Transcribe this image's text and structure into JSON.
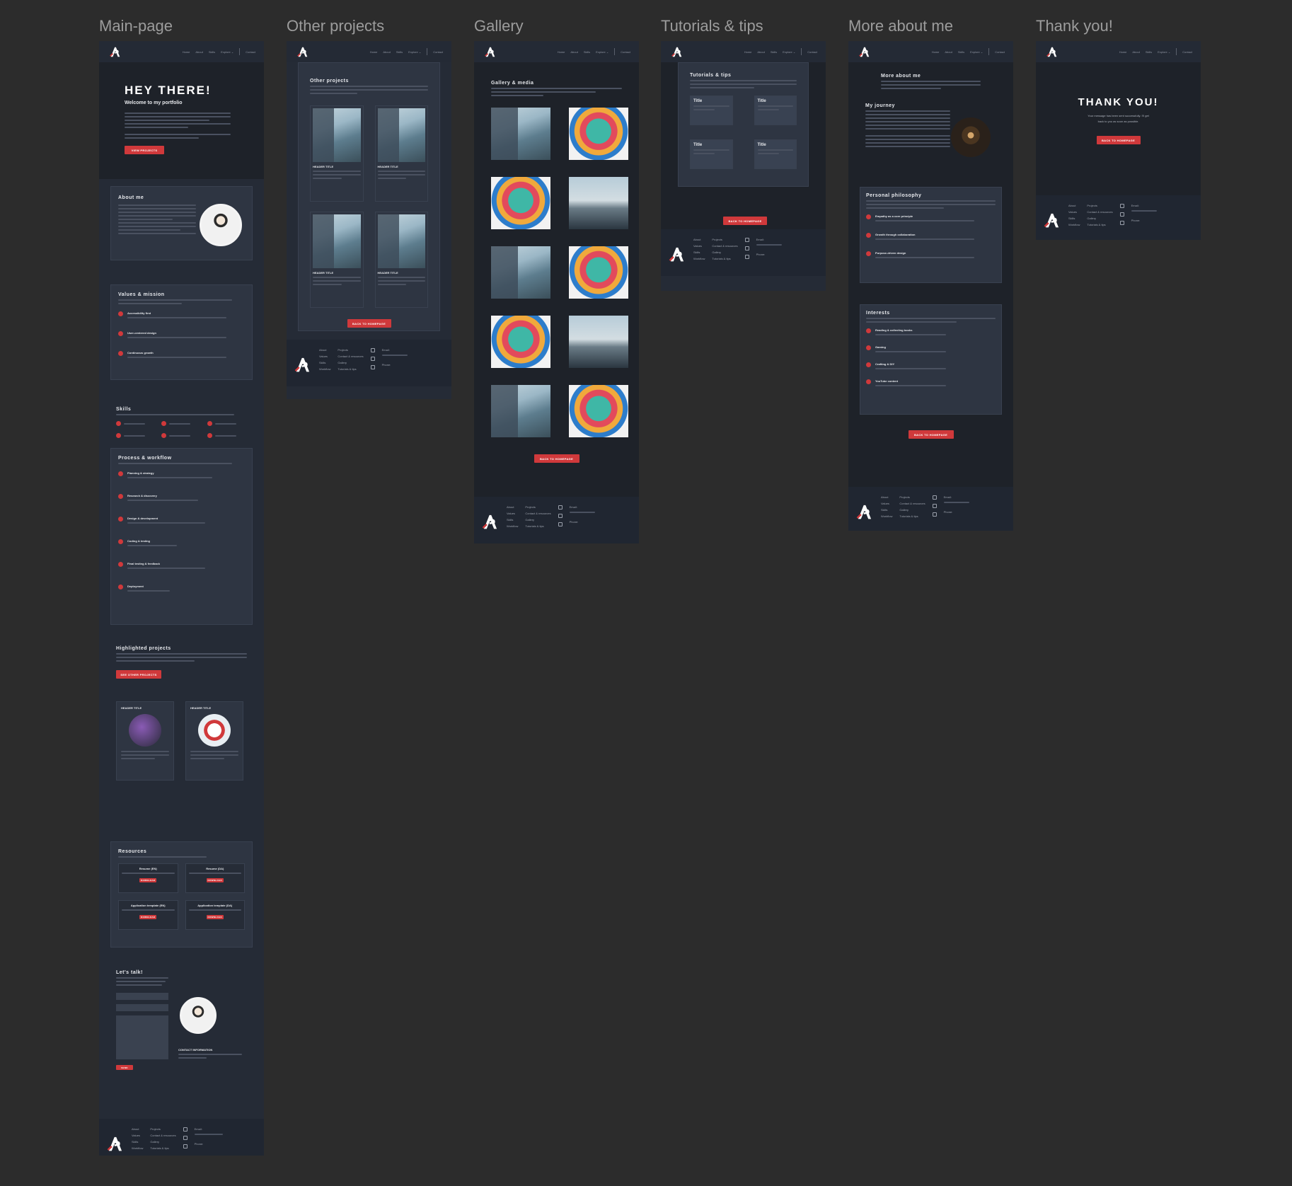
{
  "frames": {
    "main": "Main-page",
    "other": "Other projects",
    "gallery": "Gallery",
    "tutorials": "Tutorials & tips",
    "more": "More about me",
    "thanks": "Thank you!"
  },
  "nav": {
    "home": "Home",
    "about": "About",
    "skills": "Skills",
    "explore": "Explore ⌄",
    "contact": "Contact"
  },
  "main": {
    "hero_title": "HEY THERE!",
    "hero_sub": "Welcome to my portfolio",
    "view_projects": "VIEW PROJECTS",
    "about_title": "About me",
    "values_title": "Values & mission",
    "values": [
      {
        "title": "Accessibility first"
      },
      {
        "title": "User-centered design"
      },
      {
        "title": "Continuous growth"
      }
    ],
    "skills_title": "Skills",
    "process_title": "Process & workflow",
    "process": [
      {
        "title": "Planning & strategy"
      },
      {
        "title": "Research & discovery"
      },
      {
        "title": "Design & development"
      },
      {
        "title": "Coding & testing"
      },
      {
        "title": "Final testing & feedback"
      },
      {
        "title": "Deployment"
      }
    ],
    "highlight_title": "Highlighted projects",
    "see_other": "SEE OTHER PROJECTS",
    "header_title": "HEADER TITLE",
    "resources_title": "Resources",
    "resources": [
      {
        "title": "Resume (EN)",
        "btn": "DOWNLOAD"
      },
      {
        "title": "Resume (DA)",
        "btn": "DOWNLOAD"
      },
      {
        "title": "Application template (EN)",
        "btn": "DOWNLOAD"
      },
      {
        "title": "Application template (DA)",
        "btn": "DOWNLOAD"
      }
    ],
    "talk_title": "Let's talk!",
    "contact_info": "CONTACT INFORMATION",
    "send": "SEND"
  },
  "other": {
    "title": "Other projects",
    "header_title": "HEADER TITLE",
    "back": "BACK TO HOMEPAGE"
  },
  "gallery": {
    "title": "Gallery & media",
    "back": "BACK TO HOMEPAGE"
  },
  "tutorials": {
    "title": "Tutorials & tips",
    "card_title": "Title",
    "back": "BACK TO HOMEPAGE"
  },
  "more": {
    "title": "More about me",
    "journey": "My journey",
    "philosophy": "Personal philosophy",
    "philosophy_items": [
      {
        "title": "Empathy as a core principle"
      },
      {
        "title": "Growth through collaboration"
      },
      {
        "title": "Purpose-driven design"
      }
    ],
    "interests": "Interests",
    "interest_items": [
      {
        "title": "Reading & collecting books"
      },
      {
        "title": "Gaming"
      },
      {
        "title": "Crafting & DIY"
      },
      {
        "title": "YouTube content"
      }
    ],
    "back": "BACK TO HOMEPAGE"
  },
  "thanks": {
    "title": "THANK YOU!",
    "line1": "Your message has been sent successfully. I'll get",
    "line2": "back to you as soon as possible.",
    "back": "BACK TO HOMEPAGE"
  },
  "footer": {
    "about": "About",
    "values": "Values",
    "skills": "Skills",
    "workflow": "Workflow",
    "projects": "Projects",
    "contact": "Contact & resources",
    "gallery": "Gallery",
    "tutorials": "Tutorials & tips",
    "email": "Email:",
    "phone": "Phone:"
  }
}
